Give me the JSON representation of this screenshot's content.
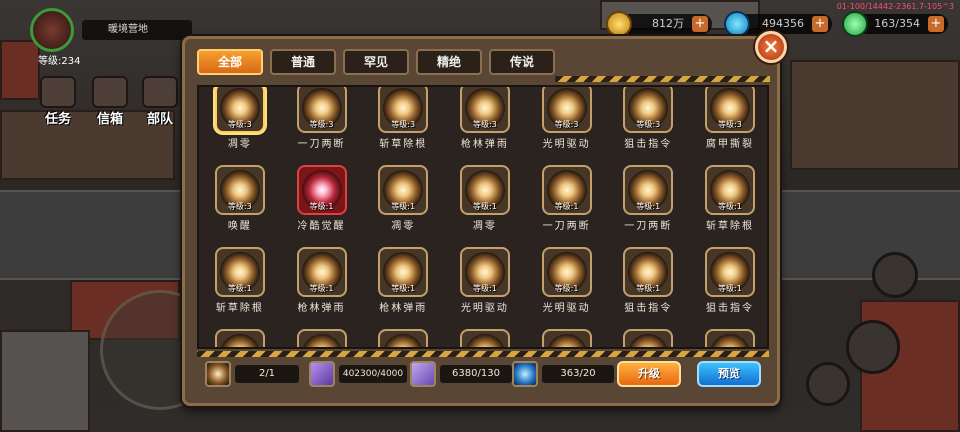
{
  "hud": {
    "player_name": "暖境营地",
    "level": "等级:234",
    "side_buttons": [
      "任务",
      "信箱",
      "部队"
    ],
    "gold": "812万",
    "gems": "494356",
    "energy": "163/354",
    "debug": "01-100/14442-2361.7-105^3",
    "plus": "+"
  },
  "panel": {
    "tabs": [
      "全部",
      "普通",
      "罕见",
      "精绝",
      "传说"
    ],
    "active_tab": 0,
    "close": "×"
  },
  "skills": [
    {
      "name": "凋零",
      "level": "等级:3",
      "style": "selected"
    },
    {
      "name": "一刀两断",
      "level": "等级:3",
      "style": "normal"
    },
    {
      "name": "斩草除根",
      "level": "等级:3",
      "style": "normal"
    },
    {
      "name": "枪林弹雨",
      "level": "等级:3",
      "style": "normal"
    },
    {
      "name": "光明驱动",
      "level": "等级:3",
      "style": "normal"
    },
    {
      "name": "狙击指令",
      "level": "等级:3",
      "style": "normal"
    },
    {
      "name": "腐甲撕裂",
      "level": "等级:3",
      "style": "normal"
    },
    {
      "name": "唤醒",
      "level": "等级:3",
      "style": "normal"
    },
    {
      "name": "冷酷觉醒",
      "level": "等级:1",
      "style": "red"
    },
    {
      "name": "凋零",
      "level": "等级:1",
      "style": "normal"
    },
    {
      "name": "凋零",
      "level": "等级:1",
      "style": "normal"
    },
    {
      "name": "一刀两断",
      "level": "等级:1",
      "style": "normal"
    },
    {
      "name": "一刀两断",
      "level": "等级:1",
      "style": "normal"
    },
    {
      "name": "斩草除根",
      "level": "等级:1",
      "style": "normal"
    },
    {
      "name": "斩草除根",
      "level": "等级:1",
      "style": "normal"
    },
    {
      "name": "枪林弹雨",
      "level": "等级:1",
      "style": "normal"
    },
    {
      "name": "枪林弹雨",
      "level": "等级:1",
      "style": "normal"
    },
    {
      "name": "光明驱动",
      "level": "等级:1",
      "style": "normal"
    },
    {
      "name": "光明驱动",
      "level": "等级:1",
      "style": "normal"
    },
    {
      "name": "狙击指令",
      "level": "等级:1",
      "style": "normal"
    },
    {
      "name": "狙击指令",
      "level": "等级:1",
      "style": "normal"
    },
    {
      "name": "",
      "level": "",
      "style": "normal"
    },
    {
      "name": "",
      "level": "",
      "style": "normal"
    },
    {
      "name": "",
      "level": "",
      "style": "normal"
    },
    {
      "name": "",
      "level": "",
      "style": "normal"
    },
    {
      "name": "",
      "level": "",
      "style": "normal"
    },
    {
      "name": "",
      "level": "",
      "style": "normal"
    },
    {
      "name": "",
      "level": "",
      "style": "normal"
    }
  ],
  "footer": {
    "slots": "2/1",
    "material1": "402300/4000",
    "material2": "6380/130",
    "material3": "363/20",
    "upgrade_label": "升级",
    "preview_label": "预览"
  },
  "colors": {
    "accent_orange": "#e86810",
    "accent_blue": "#1070d0",
    "panel": "#5a4634"
  }
}
